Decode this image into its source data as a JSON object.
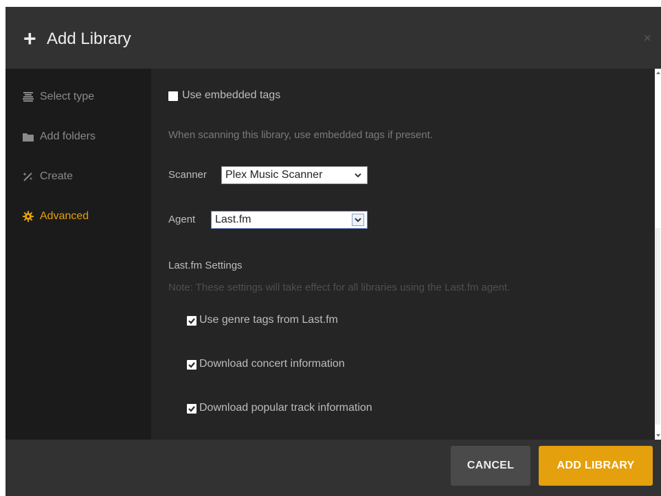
{
  "header": {
    "plus_glyph": "+",
    "title": "Add Library",
    "close_glyph": "×"
  },
  "sidebar": {
    "items": [
      {
        "label": "Select type",
        "icon": "stack-icon",
        "active": false
      },
      {
        "label": "Add folders",
        "icon": "folder-icon",
        "active": false
      },
      {
        "label": "Create",
        "icon": "magic-wand-icon",
        "active": false
      },
      {
        "label": "Advanced",
        "icon": "gear-icon",
        "active": true
      }
    ]
  },
  "content": {
    "embedded_tags": {
      "label": "Use embedded tags",
      "checked": false,
      "help": "When scanning this library, use embedded tags if present."
    },
    "scanner": {
      "label": "Scanner",
      "value": "Plex Music Scanner"
    },
    "agent": {
      "label": "Agent",
      "value": "Last.fm"
    },
    "lastfm": {
      "heading": "Last.fm Settings",
      "note": "Note: These settings will take effect for all libraries using the Last.fm agent.",
      "options": [
        {
          "label": "Use genre tags from Last.fm",
          "checked": true
        },
        {
          "label": "Download concert information",
          "checked": true
        },
        {
          "label": "Download popular track information",
          "checked": true
        }
      ]
    }
  },
  "footer": {
    "cancel_label": "CANCEL",
    "add_label": "ADD LIBRARY"
  },
  "colors": {
    "accent": "#e5a00d",
    "header_bg": "#323232",
    "sidebar_bg": "#1b1b1b",
    "content_bg": "#252525"
  }
}
